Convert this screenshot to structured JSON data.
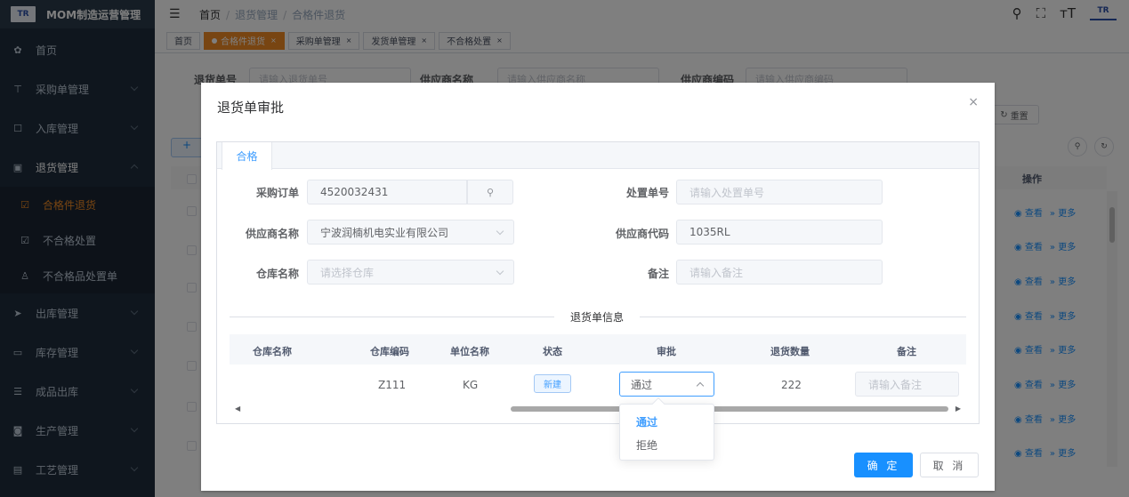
{
  "app": {
    "title": "MOM制造运营管理",
    "logo_text": "TR"
  },
  "sidebar": {
    "items": [
      {
        "label": "首页",
        "icon": "dashboard-icon"
      },
      {
        "label": "采购单管理",
        "icon": "cart-icon"
      },
      {
        "label": "入库管理",
        "icon": "edit-icon"
      },
      {
        "label": "退货管理",
        "icon": "box-icon"
      },
      {
        "label": "合格件退货",
        "icon": "doc-icon"
      },
      {
        "label": "不合格处置",
        "icon": "doc-icon"
      },
      {
        "label": "不合格品处置单",
        "icon": "user-icon"
      },
      {
        "label": "出库管理",
        "icon": "send-icon"
      },
      {
        "label": "库存管理",
        "icon": "monitor-icon"
      },
      {
        "label": "成品出库",
        "icon": "list-icon"
      },
      {
        "label": "生产管理",
        "icon": "square-icon"
      },
      {
        "label": "工艺管理",
        "icon": "layers-icon"
      }
    ]
  },
  "breadcrumb": {
    "home": "首页",
    "level1": "退货管理",
    "level2": "合格件退货"
  },
  "tags": [
    {
      "label": "首页"
    },
    {
      "label": "合格件退货"
    },
    {
      "label": "采购单管理"
    },
    {
      "label": "发货单管理"
    },
    {
      "label": "不合格处置"
    }
  ],
  "filters": {
    "return_no_label": "退货单号",
    "return_no_placeholder": "请输入退货单号",
    "supplier_name_label": "供应商名称",
    "supplier_name_placeholder": "请输入供应商名称",
    "supplier_code_label": "供应商编码",
    "supplier_code_placeholder": "请输入供应商编码",
    "reset": "重置",
    "add": "+"
  },
  "table": {
    "op_header": "操作",
    "view": "查看",
    "more": "更多"
  },
  "dialog": {
    "title": "退货单审批",
    "close": "×",
    "tab": "合格",
    "po_label": "采购订单",
    "po_value": "4520032431",
    "disposal_label": "处置单号",
    "disposal_placeholder": "请输入处置单号",
    "supplier_label": "供应商名称",
    "supplier_value": "宁波润楠机电实业有限公司",
    "supplier_code_label": "供应商代码",
    "supplier_code_value": "1035RL",
    "warehouse_label": "仓库名称",
    "warehouse_placeholder": "请选择仓库",
    "remark_label": "备注",
    "remark_placeholder": "请输入备注",
    "section_title": "退货单信息",
    "columns": [
      "仓库名称",
      "仓库编码",
      "单位名称",
      "状态",
      "审批",
      "退货数量",
      "备注"
    ],
    "row": {
      "warehouse": "",
      "code": "Z111",
      "unit": "KG",
      "status": "新建",
      "approval": "通过",
      "qty": "222",
      "note_placeholder": "请输入备注"
    },
    "options": [
      "通过",
      "拒绝"
    ],
    "ok": "确 定",
    "cancel": "取 消"
  }
}
